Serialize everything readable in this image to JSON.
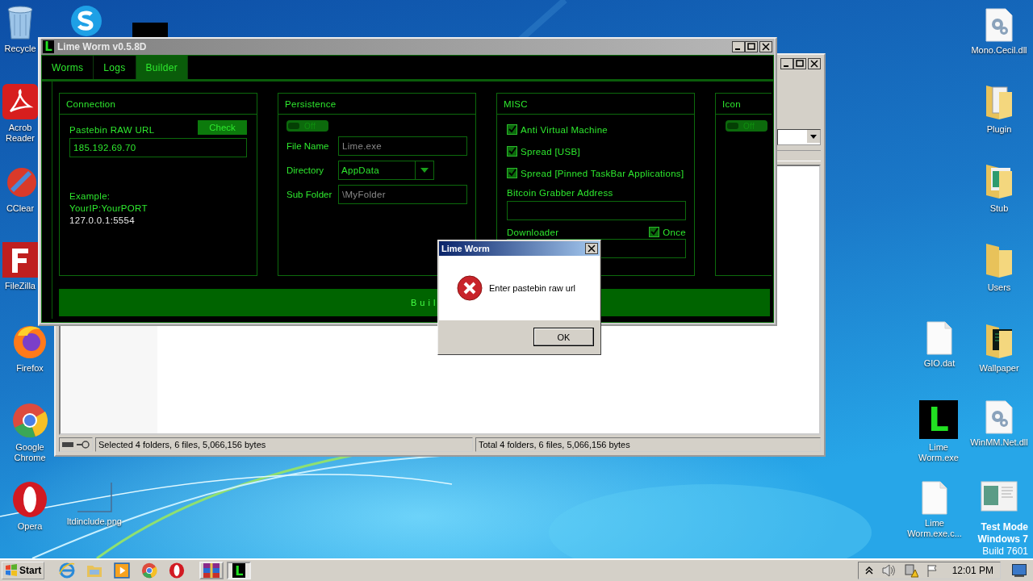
{
  "desktop": {
    "icons_left": [
      {
        "label": "Recycle",
        "kind": "recycle"
      },
      {
        "kind": "skype"
      },
      {
        "kind": "blackapp"
      },
      {
        "label": "Acrob Reader",
        "kind": "acrobat"
      },
      {
        "label": "CClear",
        "kind": "ccleaner"
      },
      {
        "label": "FileZilla",
        "kind": "filezilla"
      },
      {
        "label": "Firefox",
        "kind": "firefox"
      },
      {
        "label": "Google Chrome",
        "kind": "chrome"
      },
      {
        "label": "Opera",
        "kind": "opera"
      },
      {
        "label": "ltdinclude.png",
        "kind": "blankimage"
      }
    ],
    "icons_right": [
      {
        "label": "Mono.Cecil.dll",
        "kind": "dll"
      },
      {
        "label": "Plugin",
        "kind": "folderdoc"
      },
      {
        "label": "Stub",
        "kind": "folderwin"
      },
      {
        "label": "Users",
        "kind": "folder"
      },
      {
        "label": "GIO.dat",
        "kind": "doc"
      },
      {
        "label": "Wallpaper",
        "kind": "folderdark"
      },
      {
        "label": "Lime Worm.exe",
        "kind": "lime",
        "glyph": "L"
      },
      {
        "label": "WinMM.Net.dll",
        "kind": "dll"
      },
      {
        "label": "Lime Worm.exe.c...",
        "kind": "doc"
      },
      {
        "kind": "picturedoc"
      }
    ],
    "watermark_lines": [
      "Test Mode",
      "Windows 7",
      "Build 7601"
    ]
  },
  "explorer": {
    "status_selected": "Selected 4 folders, 6 files, 5,066,156 bytes",
    "status_total": "Total 4 folders, 6 files, 5,066,156 bytes"
  },
  "app": {
    "glyph": "L",
    "title": "Lime Worm v0.5.8D",
    "tabs": [
      {
        "label": "Worms",
        "selected": false
      },
      {
        "label": "Logs",
        "selected": false
      },
      {
        "label": "Builder",
        "selected": true
      }
    ],
    "connection": {
      "title": "Connection",
      "url_label": "Pastebin RAW URL",
      "check_button": "Check",
      "url_value": "185.192.69.70",
      "example": [
        "Example:",
        "YourIP:YourPORT",
        "127.0.0.1:5554"
      ]
    },
    "persistence": {
      "title": "Persistence",
      "toggle": {
        "label": "Off",
        "on": false
      },
      "fields": [
        {
          "label": "File Name",
          "value": "Lime.exe",
          "kind": "text"
        },
        {
          "label": "Directory",
          "value": "AppData",
          "kind": "select"
        },
        {
          "label": "Sub Folder",
          "value": "\\MyFolder",
          "kind": "text"
        }
      ]
    },
    "misc": {
      "title": "MISC",
      "checks": [
        {
          "label": "Anti Virtual Machine",
          "checked": true
        },
        {
          "label": "Spread [USB]",
          "checked": true
        },
        {
          "label": "Spread [Pinned TaskBar Applications]",
          "checked": true
        }
      ],
      "bitcoin_label": "Bitcoin Grabber Address",
      "downloader_label": "Downloader",
      "once": {
        "label": "Once",
        "checked": true
      }
    },
    "icon_panel": {
      "title": "Icon",
      "toggle": {
        "label": "Off",
        "on": false
      }
    },
    "build_button": "Buil"
  },
  "dialog": {
    "title": "Lime Worm",
    "message": "Enter pastebin raw url",
    "button": "OK"
  },
  "taskbar": {
    "start": "Start",
    "quick_launch": [
      {
        "kind": "ie"
      },
      {
        "kind": "explorer"
      },
      {
        "kind": "media"
      },
      {
        "kind": "chrome"
      },
      {
        "kind": "opera"
      }
    ],
    "tasks": [
      {
        "kind": "archive",
        "selected": false
      },
      {
        "kind": "lime",
        "glyph": "L",
        "selected": true
      }
    ],
    "tray": [
      {
        "kind": "arrow"
      },
      {
        "kind": "speaker"
      },
      {
        "kind": "network"
      },
      {
        "kind": "flag"
      }
    ],
    "clock": "12:01 PM"
  }
}
